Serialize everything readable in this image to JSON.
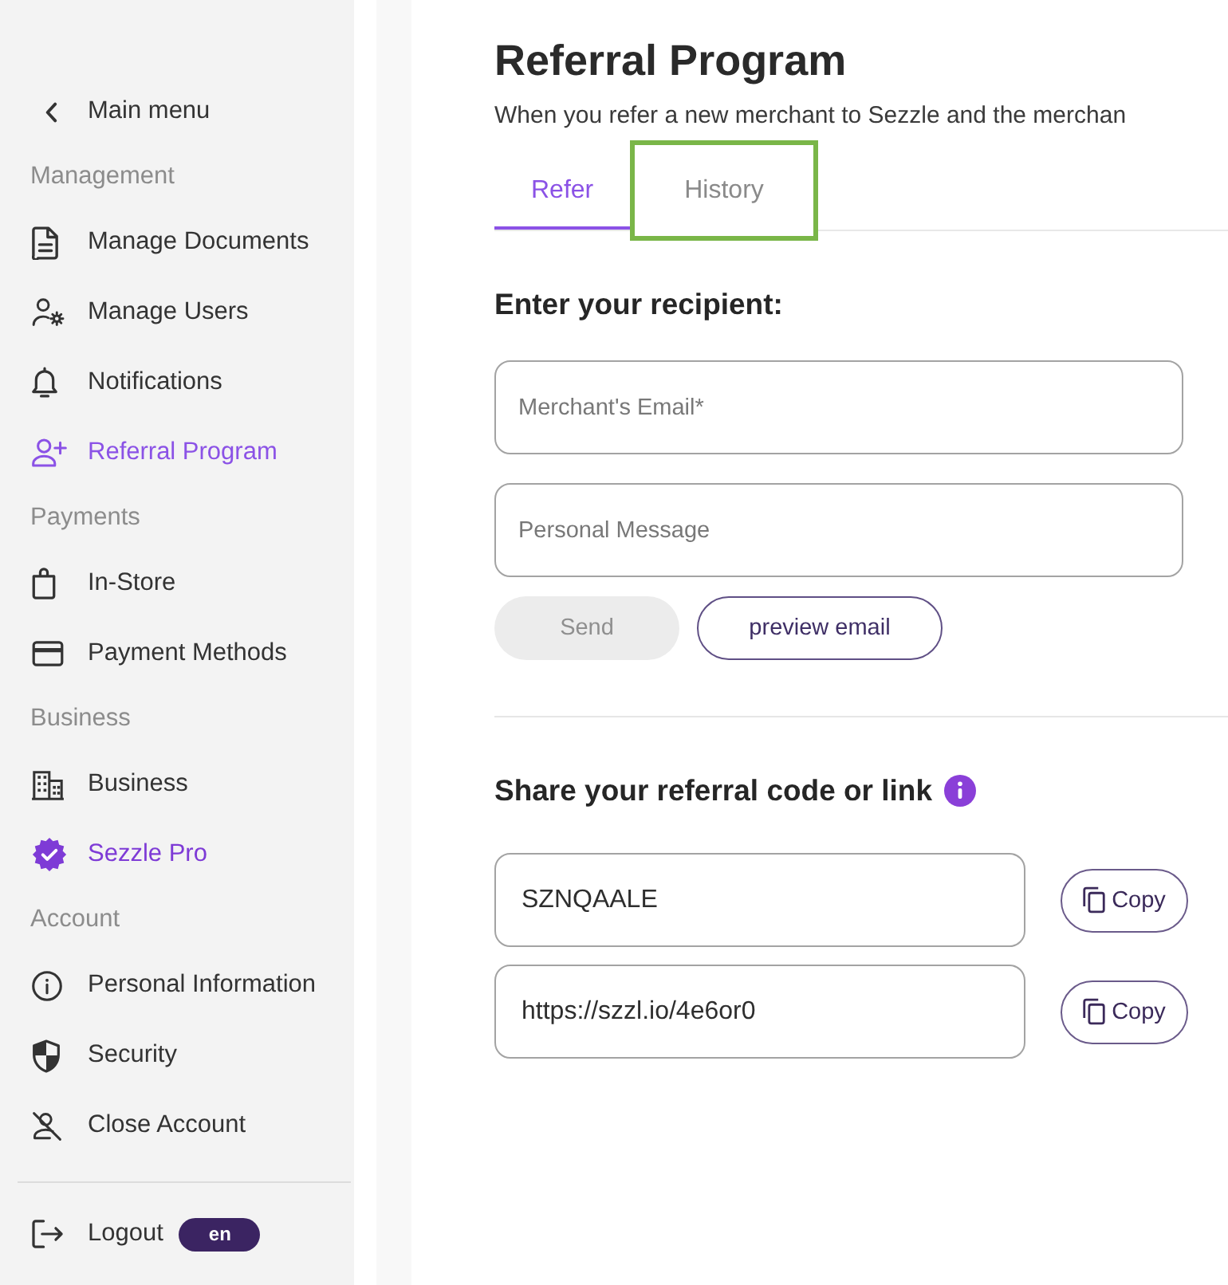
{
  "sidebar": {
    "back_link": {
      "label": "Main menu"
    },
    "sections": [
      {
        "title": "Management",
        "items": [
          {
            "label": "Manage Documents",
            "kind": "standard",
            "selected": false
          },
          {
            "label": "Manage Users",
            "kind": "standard",
            "selected": false
          },
          {
            "label": "Notifications",
            "kind": "standard",
            "selected": false
          },
          {
            "label": "Referral Program",
            "kind": "standard",
            "selected": true
          }
        ]
      },
      {
        "title": "Payments",
        "items": [
          {
            "label": "In-Store",
            "kind": "standard",
            "selected": false
          },
          {
            "label": "Payment Methods",
            "kind": "standard",
            "selected": false
          }
        ]
      },
      {
        "title": "Business",
        "items": [
          {
            "label": "Business",
            "kind": "standard",
            "selected": false
          },
          {
            "label": "Sezzle Pro",
            "kind": "featured",
            "selected": false
          }
        ]
      },
      {
        "title": "Account",
        "items": [
          {
            "label": "Personal Information",
            "kind": "standard",
            "selected": false
          },
          {
            "label": "Security",
            "kind": "standard",
            "selected": false
          },
          {
            "label": "Close Account",
            "kind": "standard",
            "selected": false
          }
        ]
      }
    ],
    "logout": {
      "label": "Logout"
    },
    "language": {
      "label": "en"
    }
  },
  "page": {
    "title": "Referral Program",
    "subtitle": "When you refer a new merchant to Sezzle and the merchan",
    "tabs": [
      {
        "label": "Refer",
        "selected": true,
        "highlighted": false
      },
      {
        "label": "History",
        "selected": false,
        "highlighted": true
      }
    ],
    "recipient_form": {
      "heading": "Enter your recipient:",
      "fields": [
        {
          "placeholder": "Merchant's Email*"
        },
        {
          "placeholder": "Personal Message"
        }
      ],
      "send_button": {
        "label": "Send",
        "disabled": true
      },
      "preview_button": {
        "label": "preview email"
      }
    },
    "share": {
      "heading": "Share your referral code or link",
      "codes": [
        {
          "value": "SZNQAALE",
          "copy_label": "Copy"
        },
        {
          "value": "https://szzl.io/4e6or0",
          "copy_label": "Copy"
        }
      ]
    }
  }
}
